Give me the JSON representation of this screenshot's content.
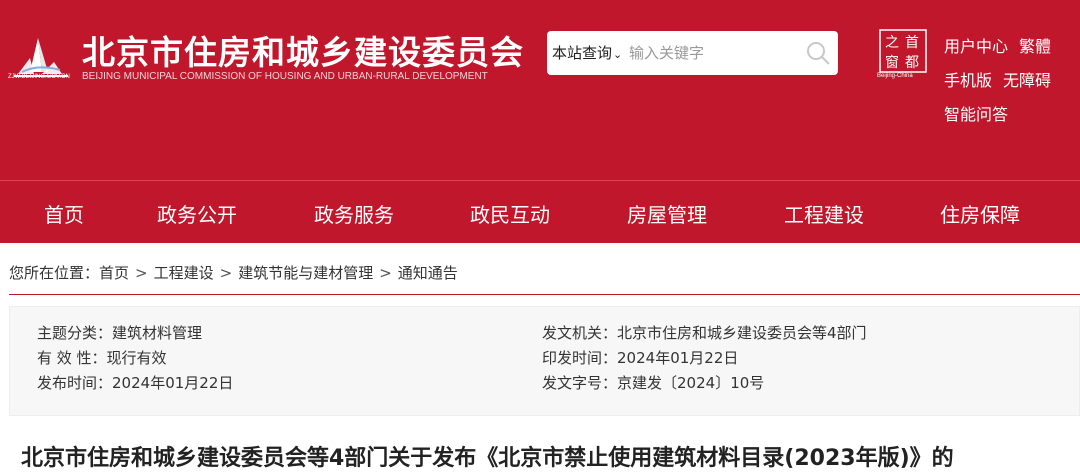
{
  "header": {
    "logo_text": "ZJW.BEIJING.GOV.CN",
    "title": "北京市住房和城乡建设委员会",
    "subtitle": "BEIJING MUNICIPAL COMMISSION OF HOUSING AND URBAN-RURAL DEVELOPMENT",
    "bg_color": "#c0172c"
  },
  "search": {
    "scope_label": "本站查询",
    "placeholder": "输入关键字",
    "icon": "search-icon"
  },
  "stamp": {
    "chars": [
      "之",
      "首",
      "窗",
      "都"
    ],
    "caption": "Beijing-China"
  },
  "utility_links": {
    "user_center": "用户中心",
    "traditional": "繁體",
    "mobile": "手机版",
    "accessible": "无障碍",
    "qa": "智能问答"
  },
  "nav": {
    "items": [
      "首页",
      "政务公开",
      "政务服务",
      "政民互动",
      "房屋管理",
      "工程建设",
      "住房保障"
    ]
  },
  "breadcrumb": {
    "prefix": "您所在位置：",
    "items": [
      "首页",
      "工程建设",
      "建筑节能与建材管理",
      "通知通告"
    ],
    "sep": ">"
  },
  "meta": {
    "topic_label": "主题分类：",
    "topic_value": "建筑材料管理",
    "validity_label": "有 效 性：",
    "validity_value": "现行有效",
    "publish_label": "发布时间：",
    "publish_value": "2024年01月22日",
    "issuer_label": "发文机关：",
    "issuer_value": "北京市住房和城乡建设委员会等4部门",
    "print_label": "印发时间：",
    "print_value": "2024年01月22日",
    "docno_label": "发文字号：",
    "docno_value": "京建发〔2024〕10号"
  },
  "doc_title": "北京市住房和城乡建设委员会等4部门关于发布《北京市禁止使用建筑材料目录(2023年版)》的"
}
